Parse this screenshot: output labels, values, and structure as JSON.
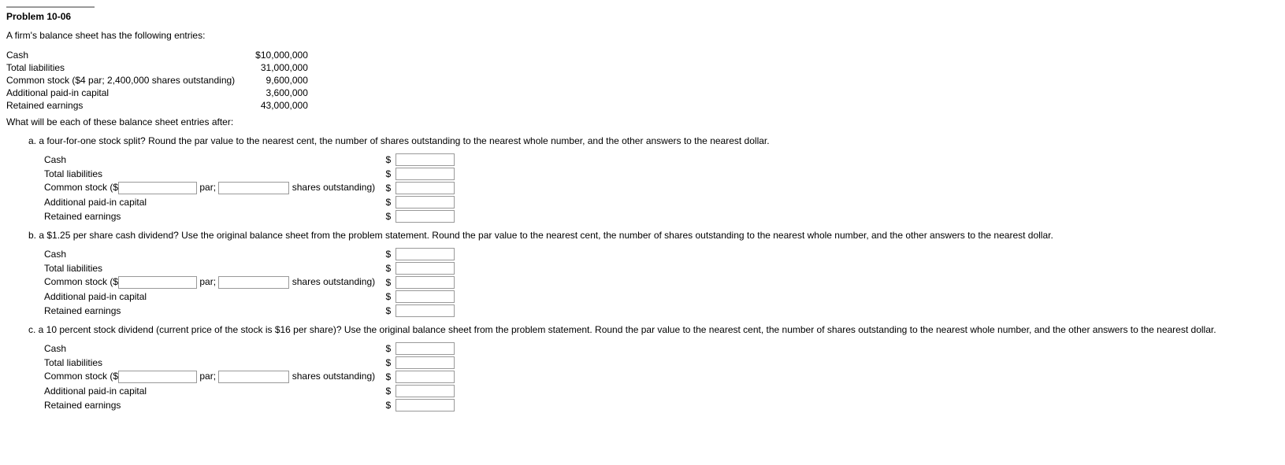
{
  "title": "Problem 10-06",
  "intro": "A firm's balance sheet has the following entries:",
  "bs_rows": [
    {
      "label": "Cash",
      "value": "$10,000,000"
    },
    {
      "label": "Total liabilities",
      "value": "31,000,000"
    },
    {
      "label": "Common stock ($4 par; 2,400,000 shares outstanding)",
      "value": "9,600,000"
    },
    {
      "label": "Additional paid-in capital",
      "value": "3,600,000"
    },
    {
      "label": "Retained earnings",
      "value": "43,000,000"
    }
  ],
  "followup": "What will be each of these balance sheet entries after:",
  "labels": {
    "cash": "Cash",
    "total_liab": "Total liabilities",
    "cs_prefix": "Common stock ($",
    "par_sep": " par; ",
    "cs_suffix": " shares outstanding)",
    "apic": "Additional paid-in capital",
    "re": "Retained earnings",
    "dollar": "$"
  },
  "parts": {
    "a": {
      "q": "a. a four-for-one stock split? Round the par value to the nearest cent, the number of shares outstanding to the nearest whole number, and the other answers to the nearest dollar."
    },
    "b": {
      "q": "b. a $1.25 per share cash dividend? Use the original balance sheet from the problem statement. Round the par value to the nearest cent, the number of shares outstanding to the nearest whole number, and the other answers to the nearest dollar."
    },
    "c": {
      "q": "c. a 10 percent stock dividend (current price of the stock is $16 per share)? Use the original balance sheet from the problem statement. Round the par value to the nearest cent, the number of shares outstanding to the nearest whole number, and the other answers to the nearest dollar."
    }
  }
}
